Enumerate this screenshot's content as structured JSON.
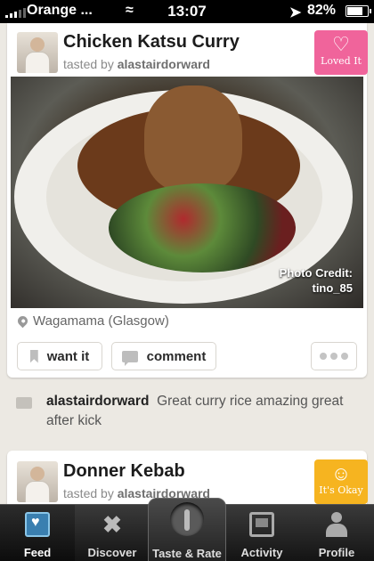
{
  "status_bar": {
    "carrier": "Orange",
    "time": "13:07",
    "battery": "82%",
    "battery_level": 0.82
  },
  "feed": [
    {
      "dish": "Chicken Katsu Curry",
      "tasted_by_prefix": "tasted by",
      "tasted_by_user": "alastairdorward",
      "rating_badge": "Loved It",
      "rating_color": "#f0649b",
      "photo_credit_label": "Photo Credit:",
      "photo_credit_user": "tino_85",
      "location": "Wagamama (Glasgow)",
      "actions": {
        "want": "want it",
        "comment": "comment"
      },
      "comment": {
        "user": "alastairdorward",
        "text": "Great curry rice amazing great after kick"
      }
    },
    {
      "dish": "Donner Kebab",
      "tasted_by_prefix": "tasted by",
      "tasted_by_user": "alastairdorward",
      "rating_badge": "It's Okay",
      "rating_color": "#f6b420"
    }
  ],
  "tabbar": {
    "items": [
      {
        "label": "Feed",
        "icon": "feed-icon",
        "active": true
      },
      {
        "label": "Discover",
        "icon": "fork-knife-icon"
      },
      {
        "label": "Taste & Rate",
        "icon": "fork-icon"
      },
      {
        "label": "Activity",
        "icon": "activity-icon"
      },
      {
        "label": "Profile",
        "icon": "person-icon"
      }
    ]
  }
}
